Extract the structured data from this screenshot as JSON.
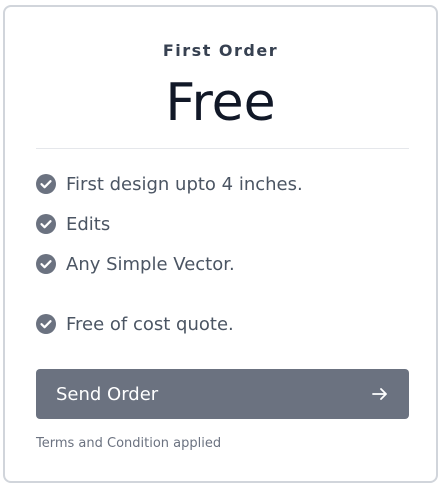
{
  "card": {
    "plan_name": "First Order",
    "price": "Free"
  },
  "features": [
    {
      "text": "First design upto 4 inches.",
      "icon": "check-circle-icon"
    },
    {
      "text": "Edits",
      "icon": "check-circle-icon"
    },
    {
      "text": "Any Simple Vector.",
      "icon": "check-circle-icon"
    },
    {
      "text": "Free of cost quote.",
      "icon": "check-circle-icon"
    }
  ],
  "action": {
    "button_label": "Send Order",
    "button_icon": "arrow-right-icon"
  },
  "footer": {
    "terms": "Terms and Condition applied"
  },
  "colors": {
    "check": "#6b7280",
    "button_bg": "#6b7280",
    "border": "#d1d5db"
  }
}
